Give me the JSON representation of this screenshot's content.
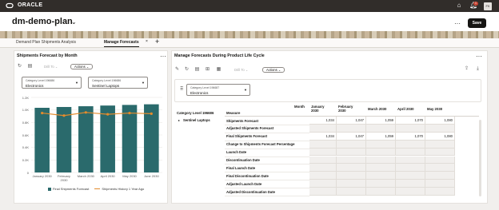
{
  "app": {
    "logo_text": "ORACLE",
    "notification_count": "1",
    "avatar_initials": "FK"
  },
  "header": {
    "title": "dm-demo-plan",
    "save_label": "Save"
  },
  "tabs": [
    {
      "label": "Demand Plan Shipments Analysis"
    },
    {
      "label": "Manage Forecasts"
    }
  ],
  "left_panel": {
    "title": "Shipments Forecast by Month",
    "drill_to": "Drill To",
    "actions": "Actions",
    "selectors": [
      {
        "label": "Category Level 196686",
        "value": "Electronics"
      },
      {
        "label": "Category Level 196686",
        "value": "Sentinel Laptops"
      }
    ]
  },
  "chart_data": {
    "type": "bar",
    "categories": [
      "January 2030",
      "February 2030",
      "March 2030",
      "April 2030",
      "May 2030",
      "June 2030"
    ],
    "x_tick_lines": [
      [
        "January 2030"
      ],
      [
        "February",
        "2030"
      ],
      [
        "March 2030"
      ],
      [
        "April 2030"
      ],
      [
        "May 2030"
      ],
      [
        "June 2030"
      ]
    ],
    "series": [
      {
        "name": "Final Shipments Forecast",
        "type": "bar",
        "color": "#2a6a6c",
        "values": [
          1034,
          1047,
          1059,
          1070,
          1080,
          1090
        ]
      },
      {
        "name": "Shipments History 1 Year Ago",
        "type": "line",
        "color": "#e38b2c",
        "values": [
          950,
          910,
          960,
          930,
          950,
          940
        ]
      }
    ],
    "y_ticks": [
      "0",
      "0.2K",
      "0.4K",
      "0.6K",
      "0.8K",
      "1.0K",
      "1.2K"
    ],
    "ylim": [
      0,
      1200
    ],
    "grid": true,
    "legend_position": "bottom"
  },
  "right_panel": {
    "title": "Manage Forecasts During Product Life Cycle",
    "drill_to": "Drill To",
    "actions": "Actions",
    "selector": {
      "label": "Category Level 196687",
      "value": "Electronics"
    },
    "col_axis_label": "Month",
    "row_dim_header": "Category Level 196686",
    "measure_header": "Measure",
    "row_member": "Sentinel Laptops",
    "months": [
      [
        "January",
        "2030"
      ],
      [
        "February",
        "2030"
      ],
      [
        "March 2030"
      ],
      [
        "April 2030"
      ],
      [
        "May 2030"
      ]
    ],
    "rows": [
      {
        "measure": "Shipments Forecast",
        "values": [
          "1,034",
          "1,047",
          "1,059",
          "1,070",
          "1,080"
        ]
      },
      {
        "measure": "Adjusted Shipments Forecast",
        "values": [
          "",
          "",
          "",
          "",
          ""
        ]
      },
      {
        "measure": "Final Shipments Forecast",
        "values": [
          "1,034",
          "1,047",
          "1,059",
          "1,070",
          "1,080"
        ]
      },
      {
        "measure": "Change to Shipments Forecast Percentage",
        "values": [
          "",
          "",
          "",
          "",
          ""
        ]
      },
      {
        "measure": "Launch Date",
        "values": [
          "",
          "",
          "",
          "",
          ""
        ]
      },
      {
        "measure": "Discontinuation Date",
        "values": [
          "",
          "",
          "",
          "",
          ""
        ]
      },
      {
        "measure": "Final Launch Date",
        "values": [
          "",
          "",
          "",
          "",
          ""
        ]
      },
      {
        "measure": "Final Discontinuation Date",
        "values": [
          "",
          "",
          "",
          "",
          ""
        ]
      },
      {
        "measure": "Adjusted Launch Date",
        "values": [
          "",
          "",
          "",
          "",
          ""
        ]
      },
      {
        "measure": "Adjusted Discontinuation Date",
        "values": [
          "",
          "",
          "",
          "",
          ""
        ]
      }
    ]
  }
}
